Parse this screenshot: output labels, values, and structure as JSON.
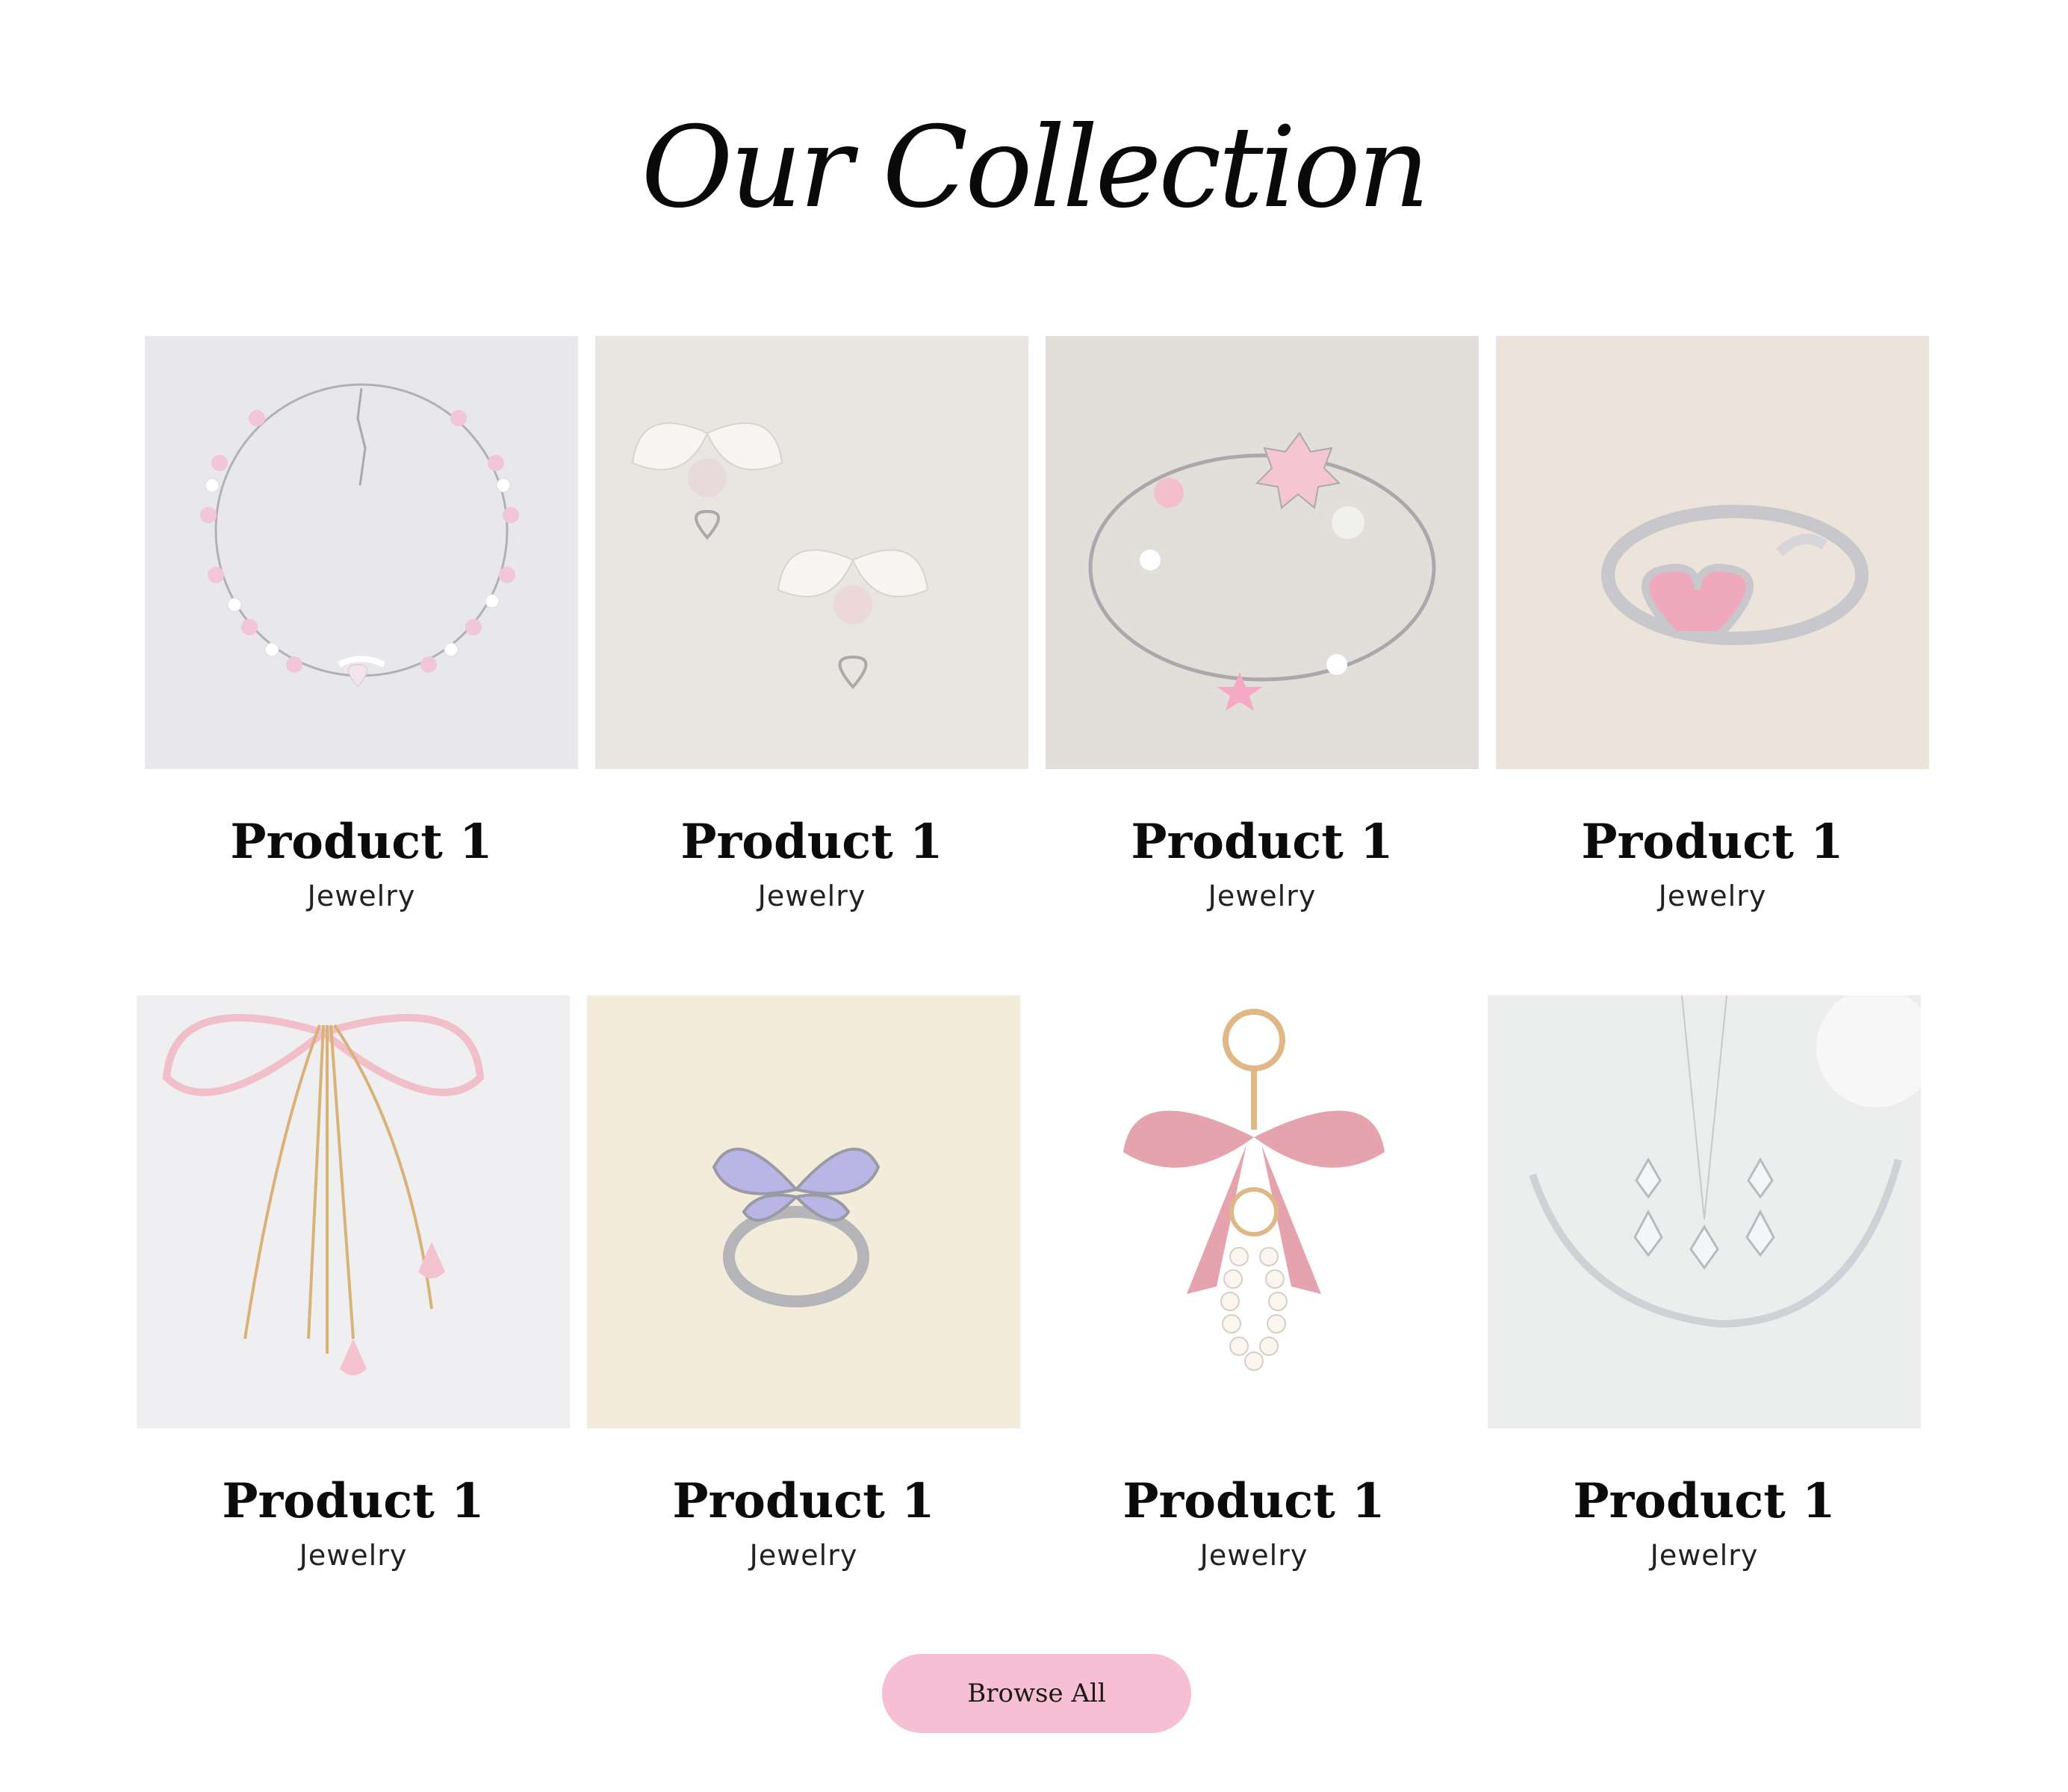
{
  "section": {
    "title": "Our Collection"
  },
  "products": [
    {
      "name": "Product 1",
      "category": "Jewelry"
    },
    {
      "name": "Product 1",
      "category": "Jewelry"
    },
    {
      "name": "Product 1",
      "category": "Jewelry"
    },
    {
      "name": "Product 1",
      "category": "Jewelry"
    },
    {
      "name": "Product 1",
      "category": "Jewelry"
    },
    {
      "name": "Product 1",
      "category": "Jewelry"
    },
    {
      "name": "Product 1",
      "category": "Jewelry"
    },
    {
      "name": "Product 1",
      "category": "Jewelry"
    }
  ],
  "actions": {
    "browse_label": "Browse All"
  },
  "colors": {
    "button": "#f7bfd3",
    "text": "#0b0b0b",
    "background": "#ffffff"
  }
}
